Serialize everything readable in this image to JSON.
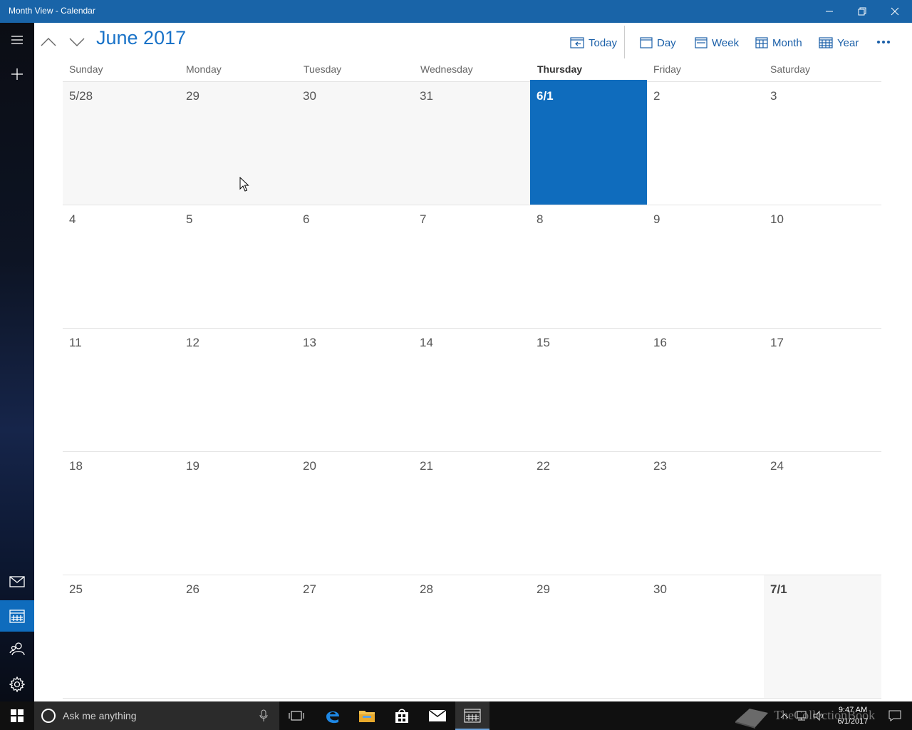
{
  "window": {
    "title": "Month View - Calendar",
    "accent": "#1964a8"
  },
  "header": {
    "month_title": "June 2017",
    "today_label": "Today",
    "day_label": "Day",
    "week_label": "Week",
    "month_label": "Month",
    "year_label": "Year"
  },
  "weekdays": [
    "Sunday",
    "Monday",
    "Tuesday",
    "Wednesday",
    "Thursday",
    "Friday",
    "Saturday"
  ],
  "calendar": {
    "today_color": "#0f6cbd",
    "weeks": [
      [
        "5/28",
        "29",
        "30",
        "31",
        "6/1",
        "2",
        "3"
      ],
      [
        "4",
        "5",
        "6",
        "7",
        "8",
        "9",
        "10"
      ],
      [
        "11",
        "12",
        "13",
        "14",
        "15",
        "16",
        "17"
      ],
      [
        "18",
        "19",
        "20",
        "21",
        "22",
        "23",
        "24"
      ],
      [
        "25",
        "26",
        "27",
        "28",
        "29",
        "30",
        "7/1"
      ]
    ]
  },
  "taskbar": {
    "search_placeholder": "Ask me anything",
    "time": "9:47 AM",
    "date": "6/1/2017"
  },
  "watermark": "TheCollectionBook"
}
